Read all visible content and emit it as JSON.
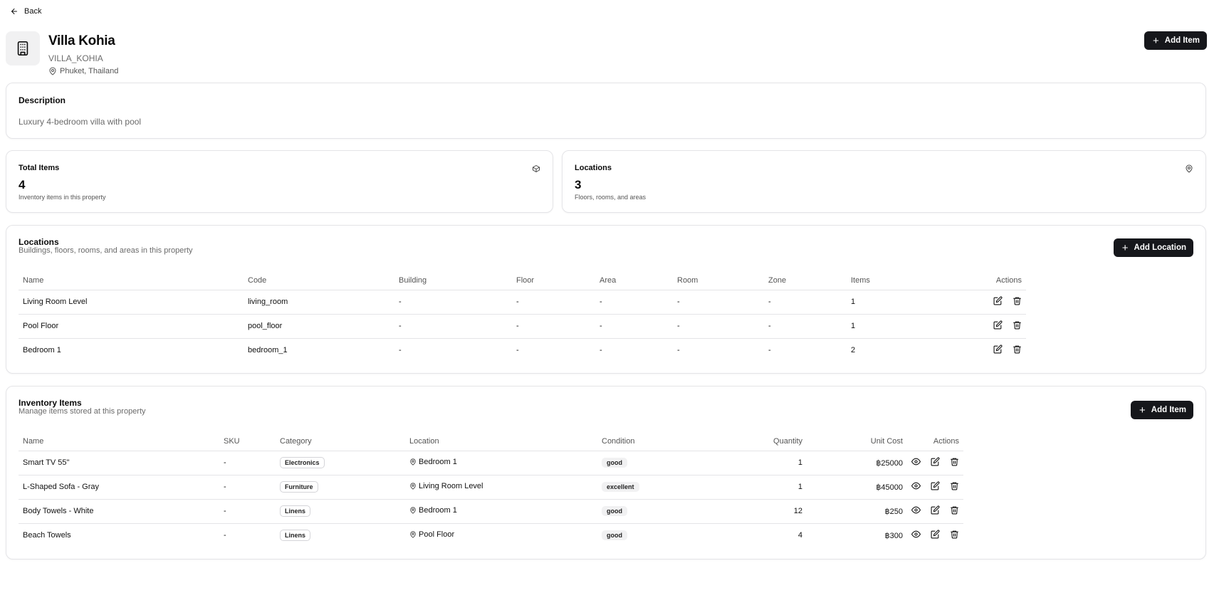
{
  "nav": {
    "back_label": "Back"
  },
  "property": {
    "name": "Villa Kohia",
    "code": "VILLA_KOHIA",
    "location": "Phuket, Thailand",
    "add_item_label": "Add Item"
  },
  "description": {
    "title": "Description",
    "text": "Luxury 4-bedroom villa with pool"
  },
  "stats": {
    "total_items": {
      "label": "Total Items",
      "value": "4",
      "sub": "Inventory items in this property",
      "icon": "package-icon"
    },
    "locations": {
      "label": "Locations",
      "value": "3",
      "sub": "Floors, rooms, and areas",
      "icon": "map-pin-icon"
    }
  },
  "locations_section": {
    "title": "Locations",
    "subtitle": "Buildings, floors, rooms, and areas in this property",
    "add_label": "Add Location",
    "columns": [
      "Name",
      "Code",
      "Building",
      "Floor",
      "Area",
      "Room",
      "Zone",
      "Items",
      "Actions"
    ],
    "rows": [
      {
        "name": "Living Room Level",
        "code": "living_room",
        "building": "-",
        "floor": "-",
        "area": "-",
        "room": "-",
        "zone": "-",
        "items": "1"
      },
      {
        "name": "Pool Floor",
        "code": "pool_floor",
        "building": "-",
        "floor": "-",
        "area": "-",
        "room": "-",
        "zone": "-",
        "items": "1"
      },
      {
        "name": "Bedroom 1",
        "code": "bedroom_1",
        "building": "-",
        "floor": "-",
        "area": "-",
        "room": "-",
        "zone": "-",
        "items": "2"
      }
    ]
  },
  "inventory_section": {
    "title": "Inventory Items",
    "subtitle": "Manage items stored at this property",
    "add_label": "Add Item",
    "columns": [
      "Name",
      "SKU",
      "Category",
      "Location",
      "Condition",
      "Quantity",
      "Unit Cost",
      "Actions"
    ],
    "rows": [
      {
        "name": "Smart TV 55\"",
        "sku": "-",
        "category": "Electronics",
        "location": "Bedroom 1",
        "condition": "good",
        "quantity": "1",
        "unit_cost": "฿25000"
      },
      {
        "name": "L-Shaped Sofa - Gray",
        "sku": "-",
        "category": "Furniture",
        "location": "Living Room Level",
        "condition": "excellent",
        "quantity": "1",
        "unit_cost": "฿45000"
      },
      {
        "name": "Body Towels - White",
        "sku": "-",
        "category": "Linens",
        "location": "Bedroom 1",
        "condition": "good",
        "quantity": "12",
        "unit_cost": "฿250"
      },
      {
        "name": "Beach Towels",
        "sku": "-",
        "category": "Linens",
        "location": "Pool Floor",
        "condition": "good",
        "quantity": "4",
        "unit_cost": "฿300"
      }
    ]
  },
  "colors": {
    "primary_button": "#16171b",
    "border": "#e4e4e7",
    "muted_text": "#6b6b6b"
  }
}
